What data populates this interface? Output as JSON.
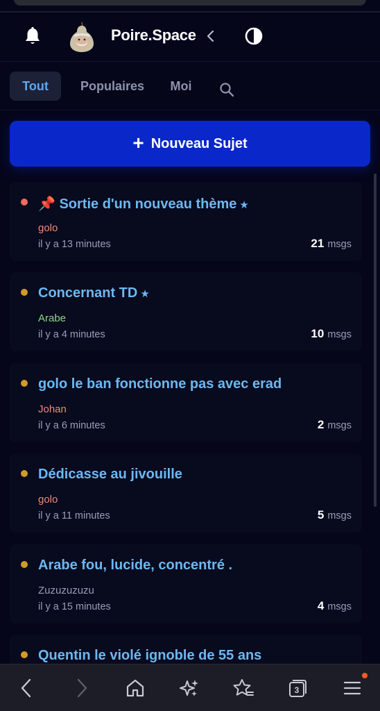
{
  "header": {
    "site_title": "Poire.Space",
    "icons": {
      "bell": "bell-icon",
      "avatar": "pear-avatar",
      "collapse": "chevron-left-icon",
      "theme": "theme-toggle-icon"
    }
  },
  "tabs": [
    {
      "label": "Tout",
      "active": true
    },
    {
      "label": "Populaires",
      "active": false
    },
    {
      "label": "Moi",
      "active": false
    }
  ],
  "search_icon": "search-icon",
  "new_topic": {
    "plus": "+",
    "label": "Nouveau Sujet"
  },
  "topics": [
    {
      "pin": "📌",
      "title": "Sortie d'un nouveau thème",
      "star": "★",
      "author": "golo",
      "author_color": "#f08a76",
      "time": "il y a 13 minutes",
      "count": "21",
      "count_unit": "msgs",
      "dot_color": "#f56a5c"
    },
    {
      "pin": "",
      "title": "Concernant TD",
      "star": "★",
      "author": "Arabe",
      "author_color": "#8fd68a",
      "time": "il y a 4 minutes",
      "count": "10",
      "count_unit": "msgs",
      "dot_color": "#d39a2a"
    },
    {
      "pin": "",
      "title": "golo le ban fonctionne pas avec erad",
      "star": "",
      "author": "Johan",
      "author_color": "#f08a76",
      "time": "il y a 6 minutes",
      "count": "2",
      "count_unit": "msgs",
      "dot_color": "#d39a2a"
    },
    {
      "pin": "",
      "title": "Dédicasse au jivouille",
      "star": "",
      "author": "golo",
      "author_color": "#f08a76",
      "time": "il y a 11 minutes",
      "count": "5",
      "count_unit": "msgs",
      "dot_color": "#d39a2a"
    },
    {
      "pin": "",
      "title": "Arabe fou, lucide, concentré .",
      "star": "",
      "author": "Zuzuzuzuzu",
      "author_color": "#9a9fb4",
      "time": "il y a 15 minutes",
      "count": "4",
      "count_unit": "msgs",
      "dot_color": "#d39a2a"
    },
    {
      "pin": "",
      "title": "Quentin le violé ignoble de 55 ans",
      "star": "",
      "author": "",
      "author_color": "#9a9fb4",
      "time": "",
      "count": "",
      "count_unit": "",
      "dot_color": "#d39a2a"
    }
  ],
  "bottom_nav": {
    "items": [
      "back-icon",
      "forward-icon",
      "home-icon",
      "sparkle-icon",
      "favorites-icon",
      "tabs-icon",
      "menu-icon"
    ],
    "tab_count": "3"
  },
  "colors": {
    "background": "#05061a",
    "accent_button": "#0a27c9",
    "title_link": "#6cb8f2",
    "active_tab": "#5aa9f0",
    "notification": "#ff5a2a"
  }
}
